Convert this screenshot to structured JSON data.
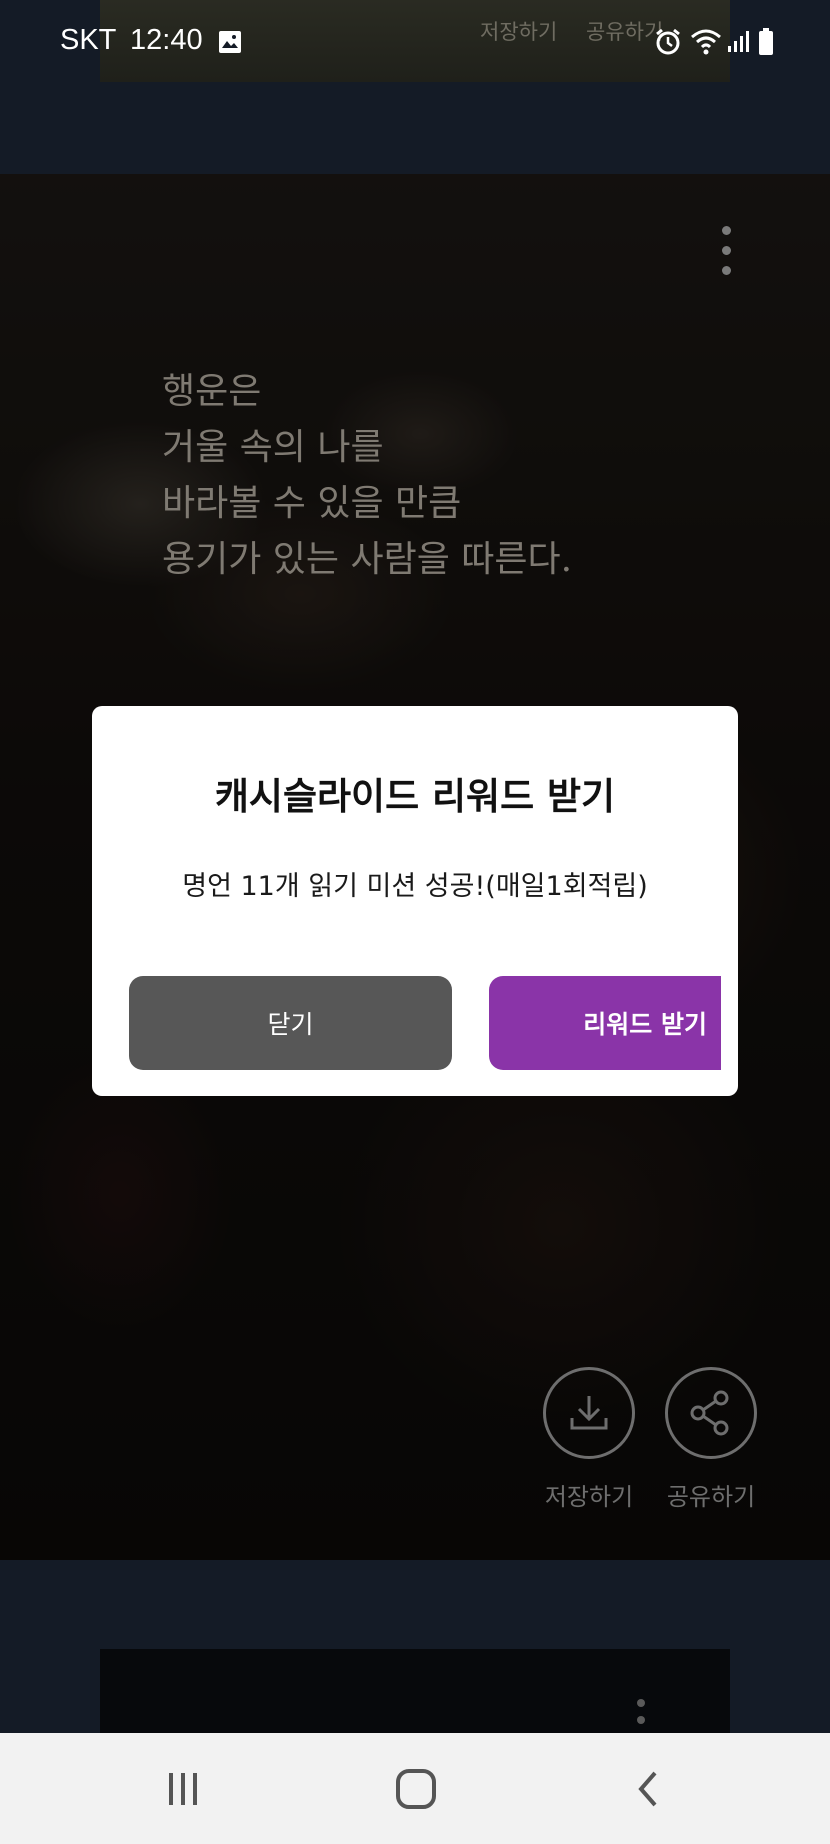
{
  "status_bar": {
    "carrier": "SKT",
    "time": "12:40",
    "icons": [
      "gallery-icon",
      "alarm-icon",
      "wifi-icon",
      "signal-icon",
      "battery-icon"
    ]
  },
  "top_card": {
    "save_label": "저장하기",
    "share_label": "공유하기"
  },
  "main_card": {
    "quote_lines": [
      "행운은",
      "거울 속의 나를",
      "바라볼 수 있을 만큼",
      "용기가 있는 사람을 따른다."
    ],
    "save_label": "저장하기",
    "share_label": "공유하기",
    "menu_icon": "more-vert-icon"
  },
  "dialog": {
    "title": "캐시슬라이드 리워드 받기",
    "message": "명언 11개 읽기 미션 성공!(매일1회적립)",
    "close_label": "닫기",
    "reward_label": "리워드 받기",
    "reward_color": "#8a34a8",
    "close_color": "#575757"
  },
  "nav_bar": {
    "icons": [
      "recent-apps-icon",
      "home-icon",
      "back-icon"
    ]
  }
}
